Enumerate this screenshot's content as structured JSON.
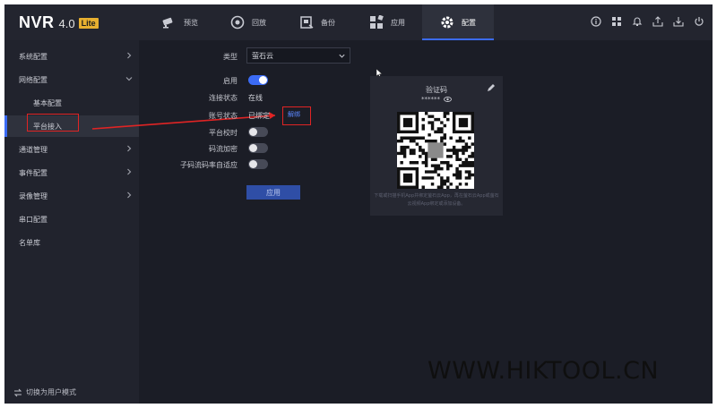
{
  "app": {
    "brand": "NVR",
    "version": "4.0",
    "badge": "Lite"
  },
  "nav": [
    {
      "label": "预览",
      "icon": "camera-icon"
    },
    {
      "label": "回放",
      "icon": "playback-icon"
    },
    {
      "label": "备份",
      "icon": "backup-icon"
    },
    {
      "label": "应用",
      "icon": "apps-icon"
    },
    {
      "label": "配置",
      "icon": "gear-icon",
      "active": true
    }
  ],
  "toolbar_icons": [
    "info-icon",
    "network-icon",
    "bell-icon",
    "export-icon",
    "download-icon",
    "power-icon"
  ],
  "sidebar": {
    "items": [
      {
        "label": "系统配置",
        "expandable": true
      },
      {
        "label": "网络配置",
        "expandable": true,
        "expanded": true
      },
      {
        "label": "基本配置",
        "sub": true
      },
      {
        "label": "平台接入",
        "sub": true,
        "selected": true
      },
      {
        "label": "通道管理",
        "expandable": true
      },
      {
        "label": "事件配置",
        "expandable": true
      },
      {
        "label": "录像管理",
        "expandable": true
      },
      {
        "label": "串口配置"
      },
      {
        "label": "名单库"
      }
    ],
    "footer": "切换为用户模式"
  },
  "form": {
    "type_label": "类型",
    "type_value": "萤石云",
    "enable_label": "启用",
    "enable_on": true,
    "conn_label": "连接状态",
    "conn_value": "在线",
    "account_label": "账号状态",
    "account_value": "已绑定",
    "unbind_link": "解绑",
    "timesync_label": "平台校时",
    "timesync_on": false,
    "encrypt_label": "码流加密",
    "encrypt_on": false,
    "adaptive_label": "子码流码率自适应",
    "adaptive_on": false,
    "apply_label": "应用"
  },
  "qr": {
    "title": "验证码",
    "password": "******",
    "hint": "下载或扫描手机App并绑定萤石云App，再在萤石云App或萤石云视频App绑定或添加设备。"
  },
  "watermark": "WWW.HIKTOOL.CN",
  "colors": {
    "accent": "#3b6bf5",
    "highlight": "#e02424",
    "link": "#5b87ff"
  }
}
